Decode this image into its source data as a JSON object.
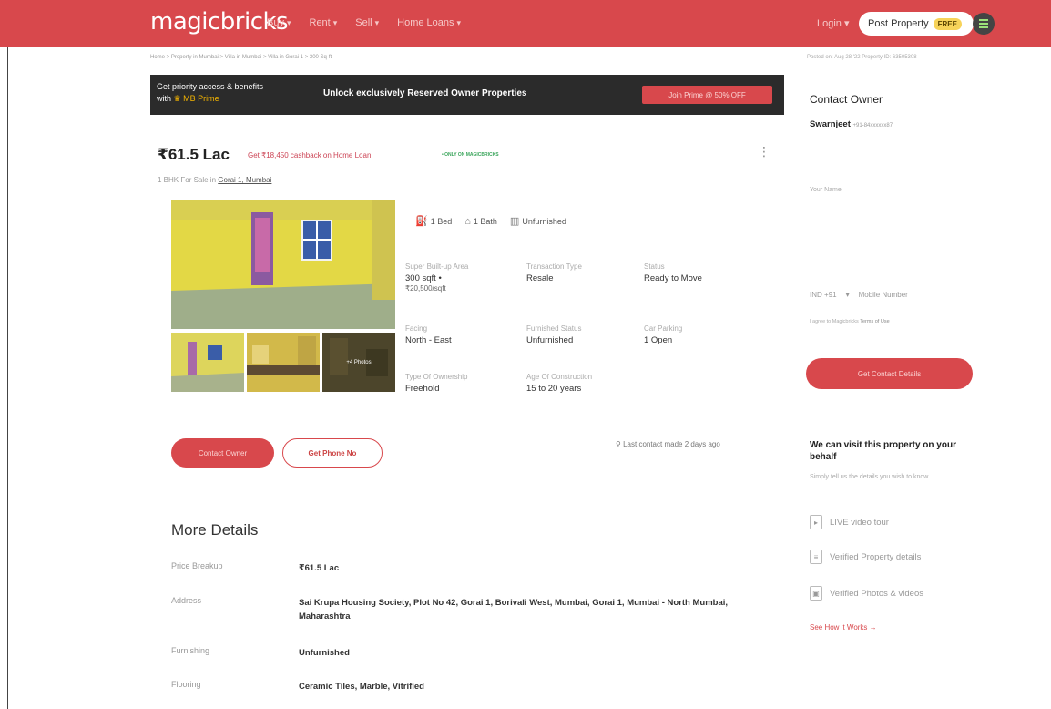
{
  "header": {
    "logo": "magicbricks",
    "nav": [
      {
        "label": "Buy"
      },
      {
        "label": "Rent"
      },
      {
        "label": "Sell"
      },
      {
        "label": "Home Loans"
      }
    ],
    "login": "Login",
    "post_property": "Post Property",
    "free_badge": "FREE"
  },
  "breadcrumb": "Home > Property in Mumbai > Villa in Mumbai > Villa in Gorai 1 > 300 Sq-ft",
  "right_meta": "Posted on: Aug 28 '22    Property ID: 63505308",
  "banner": {
    "line1": "Get priority access & benefits",
    "line2_prefix": "with",
    "line2_mb": "MB Prime",
    "middle": "Unlock exclusively Reserved Owner Properties",
    "button": "Join Prime @ 50% OFF"
  },
  "listing": {
    "price": "₹61.5 Lac",
    "cashback": "Get ₹18,450 cashback on Home Loan",
    "only_on": "• ONLY ON MAGICBRICKS",
    "subtitle_prefix": "1 BHK For Sale in",
    "subtitle_location": "Gorai 1, Mumbai",
    "more_photos": "+4 Photos",
    "features": [
      {
        "icon": "bed-icon",
        "label": "1 Bed"
      },
      {
        "icon": "bath-icon",
        "label": "1 Bath"
      },
      {
        "icon": "furnishing-icon",
        "label": "Unfurnished"
      }
    ],
    "specs": {
      "area_label": "Super Built-up Area",
      "area_value": "300 sqft",
      "area_rate": "₹20,500/sqft",
      "transaction_label": "Transaction Type",
      "transaction_value": "Resale",
      "status_label": "Status",
      "status_value": "Ready to Move",
      "facing_label": "Facing",
      "facing_value": "North - East",
      "furnished_label": "Furnished Status",
      "furnished_value": "Unfurnished",
      "parking_label": "Car Parking",
      "parking_value": "1 Open",
      "ownership_label": "Type Of Ownership",
      "ownership_value": "Freehold",
      "age_label": "Age Of Construction",
      "age_value": "15 to 20 years"
    },
    "contact_owner": "Contact Owner",
    "get_phone": "Get Phone No",
    "last_contact": "Last contact made 2 days ago"
  },
  "more_details": {
    "title": "More Details",
    "rows": [
      {
        "key": "Price Breakup",
        "value": "₹61.5 Lac"
      },
      {
        "key": "Address",
        "value": "Sai Krupa Housing Society, Plot No 42, Gorai 1, Borivali West, Mumbai, Gorai 1, Mumbai - North Mumbai, Maharashtra"
      },
      {
        "key": "Furnishing",
        "value": "Unfurnished"
      },
      {
        "key": "Flooring",
        "value": "Ceramic Tiles, Marble, Vitrified"
      }
    ]
  },
  "sidebar": {
    "title": "Contact Owner",
    "owner_name": "Swarnjeet",
    "owner_masked": "+91-84xxxxxx87",
    "name_placeholder": "Your Name",
    "country_code": "IND +91",
    "mobile_placeholder": "Mobile Number",
    "terms_prefix": "I agree to Magicbricks",
    "terms_link": "Terms of Use",
    "get_contact": "Get Contact Details",
    "visit_title": "We can visit this property on your behalf",
    "visit_sub": "Simply tell us the details you wish to know",
    "visit_items": [
      {
        "icon": "video-icon",
        "label": "LIVE video tour"
      },
      {
        "icon": "document-icon",
        "label": "Verified Property details"
      },
      {
        "icon": "photo-icon",
        "label": "Verified Photos & videos"
      }
    ],
    "see_how": "See How it Works →"
  },
  "colors": {
    "brand": "#d8484c",
    "banner_bg": "#2b2b2b",
    "free_badge": "#f7d35a"
  }
}
